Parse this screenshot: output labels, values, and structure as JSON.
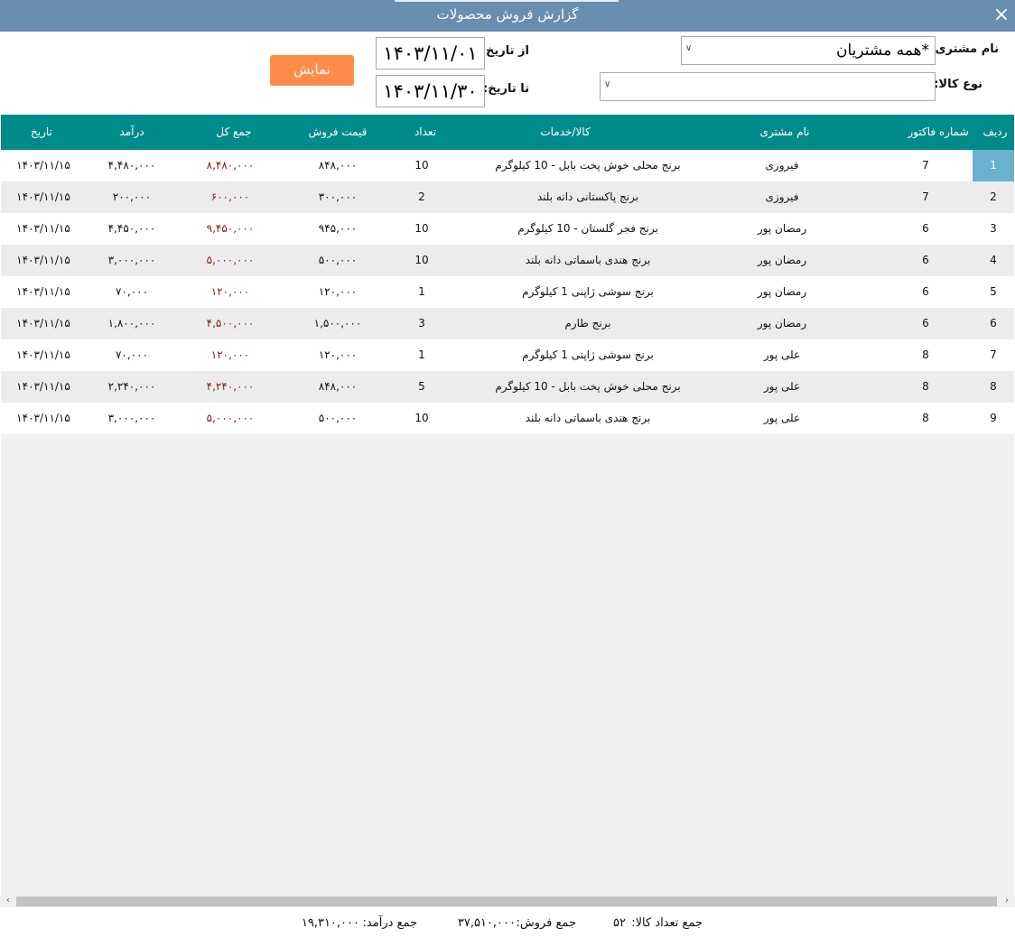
{
  "window": {
    "title": "گزارش فروش محصولات",
    "close_icon": "×"
  },
  "filters": {
    "customer_label": "نام مشتری:",
    "customer_value": "*همه مشتریان",
    "product_type_label": "نوع کالا:",
    "product_type_value": "",
    "from_label": "از تاریخ:",
    "from_value": "۱۴۰۳/۱۱/۰۱",
    "to_label": "تا تاریخ:",
    "to_value": "۱۴۰۳/۱۱/۳۰",
    "show_button": "نمایش",
    "combo_arrow": "∨"
  },
  "grid": {
    "columns": [
      "ردیف",
      "شماره فاکتور",
      "نام مشتری",
      "کالا/خدمات",
      "تعداد",
      "قیمت فروش",
      "جمع کل",
      "درآمد",
      "تاریخ"
    ],
    "rows": [
      {
        "idx": "1",
        "invoice": "7",
        "customer": "فیروزی",
        "product": "برنج محلی خوش پخت بابل - 10 کیلوگرم",
        "qty": "10",
        "price": "۸۴۸,۰۰۰",
        "total": "۸,۴۸۰,۰۰۰",
        "income": "۴,۴۸۰,۰۰۰",
        "date": "۱۴۰۳/۱۱/۱۵"
      },
      {
        "idx": "2",
        "invoice": "7",
        "customer": "فیروزی",
        "product": "برنج پاکستانی دانه بلند",
        "qty": "2",
        "price": "۳۰۰,۰۰۰",
        "total": "۶۰۰,۰۰۰",
        "income": "۲۰۰,۰۰۰",
        "date": "۱۴۰۳/۱۱/۱۵"
      },
      {
        "idx": "3",
        "invoice": "6",
        "customer": "رمضان پور",
        "product": "برنج فجر گلستان - 10 کیلوگرم",
        "qty": "10",
        "price": "۹۴۵,۰۰۰",
        "total": "۹,۴۵۰,۰۰۰",
        "income": "۴,۴۵۰,۰۰۰",
        "date": "۱۴۰۳/۱۱/۱۵"
      },
      {
        "idx": "4",
        "invoice": "6",
        "customer": "رمضان پور",
        "product": "برنج هندی باسماتی دانه بلند",
        "qty": "10",
        "price": "۵۰۰,۰۰۰",
        "total": "۵,۰۰۰,۰۰۰",
        "income": "۳,۰۰۰,۰۰۰",
        "date": "۱۴۰۳/۱۱/۱۵"
      },
      {
        "idx": "5",
        "invoice": "6",
        "customer": "رمضان پور",
        "product": "برنج سوشی ژاپنی 1 کیلوگرم",
        "qty": "1",
        "price": "۱۲۰,۰۰۰",
        "total": "۱۲۰,۰۰۰",
        "income": "۷۰,۰۰۰",
        "date": "۱۴۰۳/۱۱/۱۵"
      },
      {
        "idx": "6",
        "invoice": "6",
        "customer": "رمضان پور",
        "product": "برنج طارم",
        "qty": "3",
        "price": "۱,۵۰۰,۰۰۰",
        "total": "۴,۵۰۰,۰۰۰",
        "income": "۱,۸۰۰,۰۰۰",
        "date": "۱۴۰۳/۱۱/۱۵"
      },
      {
        "idx": "7",
        "invoice": "8",
        "customer": "علی پور",
        "product": "برنج سوشی ژاپنی 1 کیلوگرم",
        "qty": "1",
        "price": "۱۲۰,۰۰۰",
        "total": "۱۲۰,۰۰۰",
        "income": "۷۰,۰۰۰",
        "date": "۱۴۰۳/۱۱/۱۵"
      },
      {
        "idx": "8",
        "invoice": "8",
        "customer": "علی پور",
        "product": "برنج محلی خوش پخت بابل - 10 کیلوگرم",
        "qty": "5",
        "price": "۸۴۸,۰۰۰",
        "total": "۴,۲۴۰,۰۰۰",
        "income": "۲,۲۴۰,۰۰۰",
        "date": "۱۴۰۳/۱۱/۱۵"
      },
      {
        "idx": "9",
        "invoice": "8",
        "customer": "علی پور",
        "product": "برنج هندی باسماتی دانه بلند",
        "qty": "10",
        "price": "۵۰۰,۰۰۰",
        "total": "۵,۰۰۰,۰۰۰",
        "income": "۳,۰۰۰,۰۰۰",
        "date": "۱۴۰۳/۱۱/۱۵"
      }
    ]
  },
  "scrollbar": {
    "left_arrow": "‹",
    "right_arrow": "›"
  },
  "footer": {
    "qty_label": "جمع تعداد کالا:",
    "qty_value": "۵۲",
    "sales_label": "جمع فروش:",
    "sales_value": "۳۷,۵۱۰,۰۰۰",
    "income_label": "جمع درآمد:",
    "income_value": "۱۹,۳۱۰,۰۰۰"
  },
  "colors": {
    "titlebar": "#6a8db2",
    "grid_header": "#008b8b",
    "show_button": "#fd8c4a",
    "selected_cell": "#6ab1cf",
    "total_text": "#8b1a1a"
  }
}
